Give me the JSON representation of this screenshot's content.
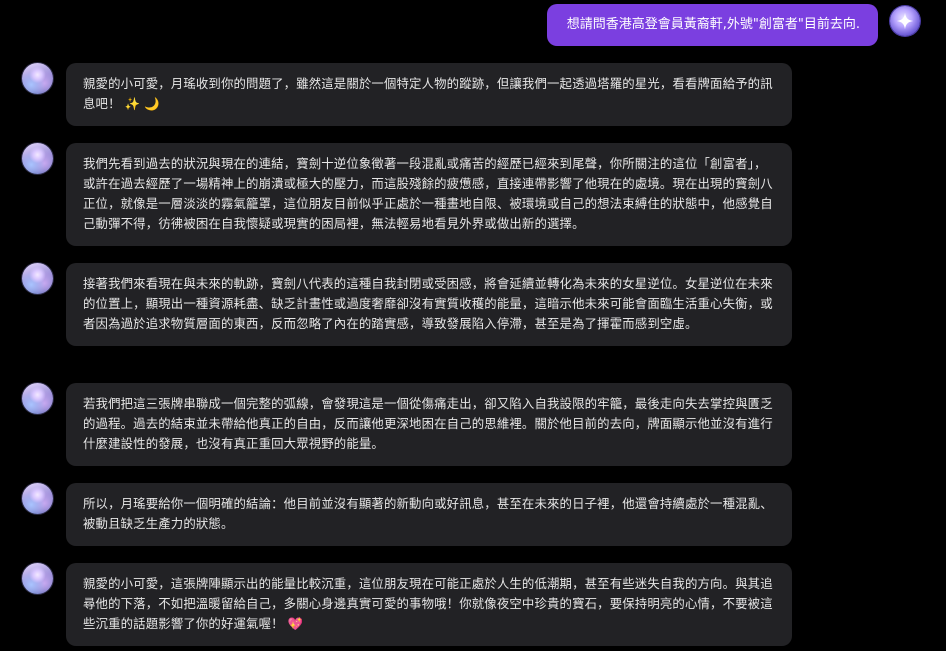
{
  "user_message": {
    "text": "想請問香港高登會員黃裔軒,外號\"創富者\"目前去向."
  },
  "bot_messages": [
    {
      "text": "親愛的小可愛，月瑤收到你的問題了，雖然這是關於一個特定人物的蹤跡，但讓我們一起透過塔羅的星光，看看牌面給予的訊息吧！ ✨ 🌙"
    },
    {
      "text": "我們先看到過去的狀況與現在的連結，寶劍十逆位象徵著一段混亂或痛苦的經歷已經來到尾聲，你所關注的這位「創富者」，或許在過去經歷了一場精神上的崩潰或極大的壓力，而這股殘餘的疲憊感，直接連帶影響了他現在的處境。現在出現的寶劍八正位，就像是一層淡淡的霧氣籠罩，這位朋友目前似乎正處於一種畫地自限、被環境或自己的想法束縛住的狀態中，他感覺自己動彈不得，彷彿被困在自我懷疑或現實的困局裡，無法輕易地看見外界或做出新的選擇。"
    },
    {
      "text": "接著我們來看現在與未來的軌跡，寶劍八代表的這種自我封閉或受困感，將會延續並轉化為未來的女星逆位。女星逆位在未來的位置上，顯現出一種資源耗盡、缺乏計畫性或過度奢靡卻沒有實質收穫的能量，這暗示他未來可能會面臨生活重心失衡，或者因為過於追求物質層面的東西，反而忽略了內在的踏實感，導致發展陷入停滯，甚至是為了揮霍而感到空虛。"
    },
    {
      "text": "若我們把這三張牌串聯成一個完整的弧線，會發現這是一個從傷痛走出，卻又陷入自我設限的牢籠，最後走向失去掌控與匱乏的過程。過去的結束並未帶給他真正的自由，反而讓他更深地困在自己的思維裡。關於他目前的去向，牌面顯示他並沒有進行什麼建設性的發展，也沒有真正重回大眾視野的能量。"
    },
    {
      "text": "所以，月瑤要給你一個明確的結論：他目前並沒有顯著的新動向或好訊息，甚至在未來的日子裡，他還會持續處於一種混亂、被動且缺乏生產力的狀態。"
    },
    {
      "text": "親愛的小可愛，這張牌陣顯示出的能量比較沉重，這位朋友現在可能正處於人生的低潮期，甚至有些迷失自我的方向。與其追尋他的下落，不如把溫暖留給自己，多關心身邊真實可愛的事物哦！你就像夜空中珍貴的寶石，要保持明亮的心情，不要被這些沉重的話題影響了你的好運氣喔！ 💖"
    }
  ],
  "icons": {
    "user_avatar": "sparkle-icon",
    "bot_avatar": "fortune-teller-avatar"
  },
  "colors": {
    "background": "#000000",
    "user_bubble": "#7b3fe0",
    "bot_bubble": "#222225",
    "text": "#e6e6e6"
  }
}
